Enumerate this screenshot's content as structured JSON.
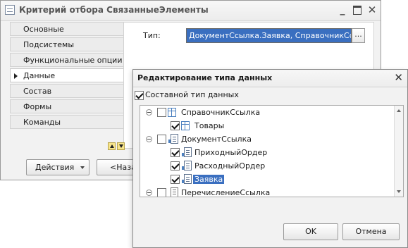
{
  "main_window": {
    "title": "Критерий отбора СвязанныеЭлементы",
    "tabs": [
      {
        "label": "Основные",
        "active": false
      },
      {
        "label": "Подсистемы",
        "active": false
      },
      {
        "label": "Функциональные опции",
        "active": false
      },
      {
        "label": "Данные",
        "active": true
      },
      {
        "label": "Состав",
        "active": false
      },
      {
        "label": "Формы",
        "active": false
      },
      {
        "label": "Команды",
        "active": false
      }
    ],
    "type_label": "Тип:",
    "type_value": "ДокументСсылка.Заявка, СправочникСсылка.Товары",
    "type_button": "...",
    "actions_button": "Действия",
    "back_button": "<Назад"
  },
  "dialog": {
    "title": "Редактирование типа данных",
    "composite_label": "Составной тип данных",
    "composite_checked": true,
    "tree": [
      {
        "label": "СправочникСсылка",
        "level": 0,
        "expanded": true,
        "checked": false,
        "icon": "catalog-icon"
      },
      {
        "label": "Товары",
        "level": 1,
        "checked": true,
        "icon": "catalog-icon"
      },
      {
        "label": "ДокументСсылка",
        "level": 0,
        "expanded": true,
        "checked": false,
        "icon": "document-icon"
      },
      {
        "label": "ПриходныйОрдер",
        "level": 1,
        "checked": true,
        "icon": "document-icon"
      },
      {
        "label": "РасходныйОрдер",
        "level": 1,
        "checked": true,
        "icon": "document-icon"
      },
      {
        "label": "Заявка",
        "level": 1,
        "checked": true,
        "icon": "document-icon",
        "selected": true
      },
      {
        "label": "ПеречислениеСсылка",
        "level": 0,
        "expanded": true,
        "checked": false,
        "icon": "enum-icon"
      }
    ],
    "ok_button": "OK",
    "cancel_button": "Отмена"
  }
}
